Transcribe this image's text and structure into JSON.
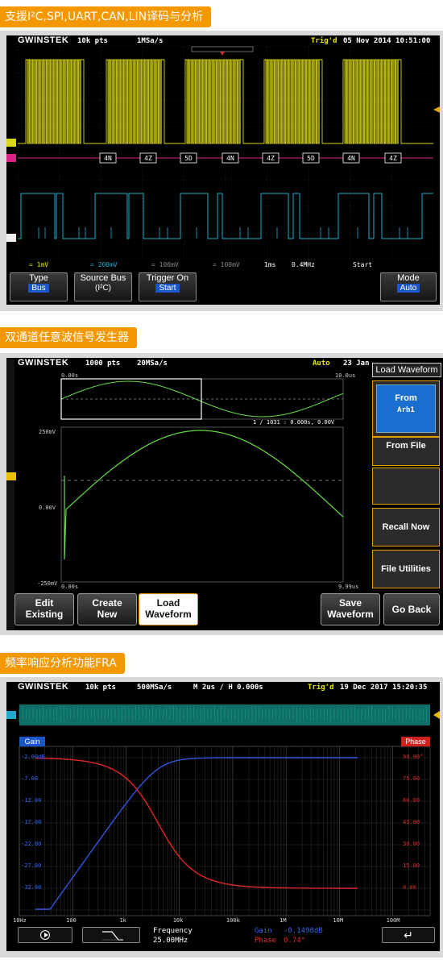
{
  "section1": {
    "title": "支援I²C,SPI,UART,CAN,LIN译码与分析",
    "header": {
      "brand": "GWINSTEK",
      "pts": "10k pts",
      "rate": "1MSa/s",
      "trig": "Trig'd",
      "datetime": "05 Nov 2014 10:51:00"
    },
    "decode_labels": [
      "4N",
      "4Z",
      "5D",
      "4N",
      "4Z",
      "5D",
      "4N",
      "4Z"
    ],
    "status": {
      "ch1": "= 1mV",
      "ch2": "= 200mV",
      "ch3": "= 100mV",
      "ch4": "= 100mV",
      "time": "1ms",
      "freq": "0.4MHz",
      "start": "Start"
    },
    "softkeys": [
      {
        "label": "Type",
        "value": "Bus"
      },
      {
        "label": "Source Bus",
        "value": "(I²C)"
      },
      {
        "label": "Trigger On",
        "value": "Start"
      },
      {
        "label": "Mode",
        "value": "Auto"
      }
    ]
  },
  "section2": {
    "title": "双通道任意波信号发生器",
    "header": {
      "brand": "GWINSTEK",
      "pts": "1000 pts",
      "rate": "20MSa/s",
      "mode": "Auto",
      "date": "23 Jan"
    },
    "overview": {
      "start": "0.00s",
      "end": "10.0us",
      "cursor": "1 / 1031 : 0.000s, 0.00V"
    },
    "main": {
      "vtop": "250mV",
      "vmid": "0.00V",
      "vbot": "-250mV",
      "tstart": "0.00s",
      "tend": "9.99us"
    },
    "side_title": "Load Waveform",
    "side": [
      {
        "label": "From",
        "value": "Arb1"
      },
      {
        "label": "From File"
      },
      {
        "label": ""
      },
      {
        "label": "Recall Now"
      },
      {
        "label": "File Utilities"
      }
    ],
    "bottom": [
      {
        "line1": "Edit",
        "line2": "Existing"
      },
      {
        "line1": "Create",
        "line2": "New"
      },
      {
        "line1": "Load",
        "line2": "Waveform"
      },
      {
        "line1": "Save",
        "line2": "Waveform"
      },
      {
        "line1": "Go Back",
        "line2": ""
      }
    ]
  },
  "section3": {
    "title": "频率响应分析功能FRA",
    "header": {
      "brand": "GWINSTEK",
      "pts": "10k pts",
      "rate": "500MSa/s",
      "timebase": "M 2us / H 0.000s",
      "trig": "Trig'd",
      "datetime": "19 Dec 2017 15:20:35"
    },
    "gain_label": "Gain",
    "phase_label": "Phase",
    "gain_ticks": [
      "-2.00dB",
      "-7.00",
      "-12.00",
      "-17.00",
      "-22.00",
      "-27.00",
      "-32.00"
    ],
    "phase_ticks": [
      "90.00°",
      "75.00",
      "60.00",
      "45.00",
      "30.00",
      "15.00",
      "0.00"
    ],
    "freq_ticks": [
      "10Hz",
      "100",
      "1k",
      "10k",
      "100k",
      "1M",
      "10M",
      "100M"
    ],
    "readout": {
      "freq_label": "Frequency",
      "freq_value": "25.00MHz",
      "gain_label": "Gain",
      "gain_value": "-0.1498dB",
      "phase_label": "Phase",
      "phase_value": "0.74°"
    }
  },
  "colors": {
    "orange": "#f39800",
    "yellow": "#d8d818",
    "cyan": "#22aacc",
    "magenta": "#dd2288",
    "green": "#66dd44",
    "blue": "#3355dd",
    "red": "#e02828"
  }
}
